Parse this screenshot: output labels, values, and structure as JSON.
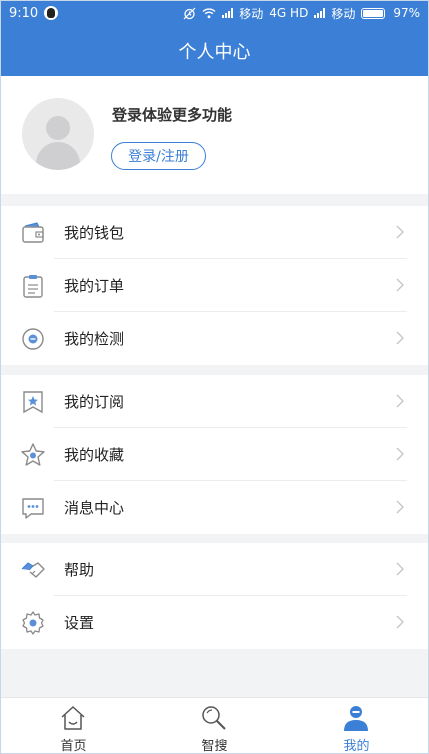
{
  "status_bar": {
    "time": "9:10",
    "carrier1": "移动",
    "network": "4G HD",
    "carrier2": "移动",
    "battery": "97%"
  },
  "header": {
    "title": "个人中心"
  },
  "profile": {
    "prompt": "登录体验更多功能",
    "login_button": "登录/注册"
  },
  "menu_groups": [
    [
      {
        "label": "我的钱包",
        "icon": "wallet-icon"
      },
      {
        "label": "我的订单",
        "icon": "clipboard-icon"
      },
      {
        "label": "我的检测",
        "icon": "inspection-icon"
      }
    ],
    [
      {
        "label": "我的订阅",
        "icon": "bookmark-star-icon"
      },
      {
        "label": "我的收藏",
        "icon": "star-icon"
      },
      {
        "label": "消息中心",
        "icon": "chat-bubble-icon"
      }
    ],
    [
      {
        "label": "帮助",
        "icon": "handshake-icon"
      },
      {
        "label": "设置",
        "icon": "gear-icon"
      }
    ]
  ],
  "bottom_nav": [
    {
      "label": "首页",
      "icon": "home-icon",
      "active": false
    },
    {
      "label": "智搜",
      "icon": "search-icon",
      "active": false
    },
    {
      "label": "我的",
      "icon": "person-icon",
      "active": true
    }
  ],
  "colors": {
    "primary": "#3b7fd6",
    "background": "#f2f3f5"
  }
}
